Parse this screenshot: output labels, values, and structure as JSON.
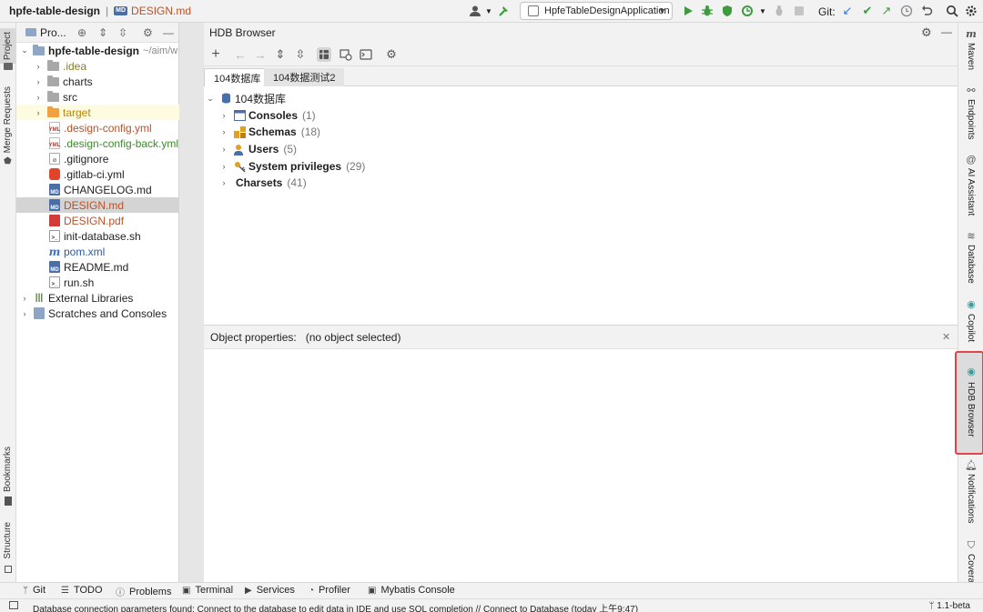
{
  "topbar": {
    "project": "hpfe-table-design",
    "file_badge": "MD",
    "file": "DESIGN.md",
    "run_config": "HpfeTableDesignApplication",
    "git_label": "Git:"
  },
  "left_strip": {
    "project": "Project",
    "merge_requests": "Merge Requests",
    "bookmarks": "Bookmarks",
    "structure": "Structure"
  },
  "project_panel": {
    "title": "Pro...",
    "root": {
      "name": "hpfe-table-design",
      "path": "~/aim/w"
    },
    "items": [
      {
        "label": ".idea",
        "type": "folder"
      },
      {
        "label": "charts",
        "type": "folder"
      },
      {
        "label": "src",
        "type": "folder"
      },
      {
        "label": "target",
        "type": "folder"
      },
      {
        "label": ".design-config.yml",
        "type": "yml"
      },
      {
        "label": ".design-config-back.yml",
        "type": "yml"
      },
      {
        "label": ".gitignore",
        "type": "git"
      },
      {
        "label": ".gitlab-ci.yml",
        "type": "gitlab"
      },
      {
        "label": "CHANGELOG.md",
        "type": "md"
      },
      {
        "label": "DESIGN.md",
        "type": "md"
      },
      {
        "label": "DESIGN.pdf",
        "type": "pdf"
      },
      {
        "label": "init-database.sh",
        "type": "sh"
      },
      {
        "label": "pom.xml",
        "type": "pom"
      },
      {
        "label": "README.md",
        "type": "md"
      },
      {
        "label": "run.sh",
        "type": "sh"
      },
      {
        "label": "External Libraries",
        "type": "lib"
      },
      {
        "label": "Scratches and Consoles",
        "type": "scratch"
      }
    ],
    "icon_labels": {
      "yml": "YML",
      "md": "MD",
      "sh": ">_"
    }
  },
  "hdb": {
    "title": "HDB Browser",
    "tabs": [
      "104数据库",
      "104数据测试2"
    ],
    "tree_root": "104数据库",
    "nodes": [
      {
        "label": "Consoles",
        "count": "(1)"
      },
      {
        "label": "Schemas",
        "count": "(18)"
      },
      {
        "label": "Users",
        "count": "(5)"
      },
      {
        "label": "System privileges",
        "count": "(29)"
      },
      {
        "label": "Charsets",
        "count": "(41)"
      }
    ],
    "props_label": "Object properties:",
    "props_value": "(no object selected)"
  },
  "right_strip": {
    "maven": "Maven",
    "endpoints": "Endpoints",
    "ai_assistant": "AI Assistant",
    "database": "Database",
    "copilot": "Copilot",
    "hdb_browser": "HDB Browser",
    "notifications": "Notifications",
    "coverage": "Covera"
  },
  "bottom_bar": {
    "git": "Git",
    "todo": "TODO",
    "problems": "Problems",
    "terminal": "Terminal",
    "services": "Services",
    "profiler": "Profiler",
    "mybatis": "Mybatis Console"
  },
  "status": {
    "message": "Database connection parameters found: Connect to the database to edit data in IDE and use SQL completion // Connect to Database (today 上午9:47)",
    "branch": "1.1-beta"
  },
  "colors": {
    "highlight_border": "#e0454a",
    "run_green": "#3f9b3f",
    "modified_file": "#b8522a"
  }
}
